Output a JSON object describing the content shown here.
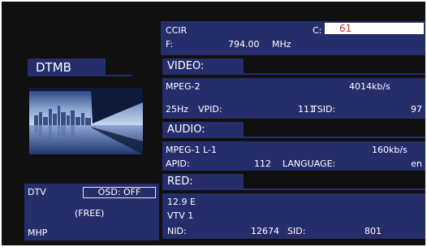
{
  "header": {
    "standard": "CCIR",
    "channel_label": "C:",
    "channel_value": "61",
    "freq_label": "F:",
    "freq_value": "794.00",
    "freq_unit": "MHz"
  },
  "left": {
    "mode_label": "DTMB",
    "dtv_label": "DTV",
    "osd_label": "OSD: OFF",
    "free_label": "(FREE)",
    "mhp_label": "MHP"
  },
  "video": {
    "title": "VIDEO:",
    "codec": "MPEG-2",
    "bitrate": "4014kb/s",
    "rate": "25Hz",
    "vpid_label": "VPID:",
    "vpid_value": "111",
    "tsid_label": "TSID:",
    "tsid_value": "97"
  },
  "audio": {
    "title": "AUDIO:",
    "codec": "MPEG-1 L-1",
    "bitrate": "160kb/s",
    "apid_label": "APID:",
    "apid_value": "112",
    "language_label": "LANGUAGE:",
    "language_value": "en"
  },
  "network": {
    "title": "RED:",
    "position": "12.9 E",
    "name": "VTV 1",
    "nid_label": "NID:",
    "nid_value": "12674",
    "sid_label": "SID:",
    "sid_value": "801"
  },
  "colors": {
    "panel": "#262d6b",
    "background": "#101010",
    "channel_value": "#c0392b"
  }
}
